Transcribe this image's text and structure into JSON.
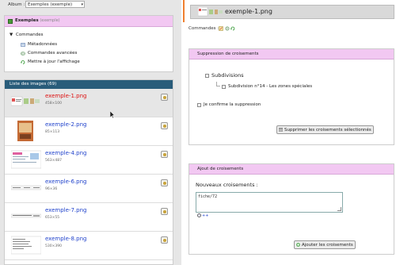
{
  "album": {
    "label": "Album :",
    "selected": "Exemples (exemple)"
  },
  "tree": {
    "root_name": "Exemples",
    "root_suffix": "(exemple)",
    "section": "Commandes",
    "items": [
      "Métadonnées",
      "Commandes avancées",
      "Mettre à jour l'affichage"
    ]
  },
  "images": {
    "header": "Liste des images (69)",
    "rows": [
      {
        "name": "exemple-1.png",
        "size": "458×100",
        "selected": true
      },
      {
        "name": "exemple-2.png",
        "size": "85×113"
      },
      {
        "name": "exemple-4.png",
        "size": "563×487"
      },
      {
        "name": "exemple-6.png",
        "size": "96×36"
      },
      {
        "name": "exemple-7.png",
        "size": "653×55"
      },
      {
        "name": "exemple-8.png",
        "size": "530×390"
      }
    ]
  },
  "detail": {
    "title": "exemple-1.png",
    "commands_label": "Commandes :"
  },
  "suppression": {
    "header": "Suppression de croisements",
    "subdivisions_label": "Subdivisions",
    "subdivision_item": "Subdivision n°14 - Les zones spéciales",
    "confirm_label": "Je confirme la suppression",
    "button": "Supprimer les croisements sélectionnés"
  },
  "ajout": {
    "header": "Ajout de croisements",
    "new_label": "Nouveaux croisements :",
    "textarea_value": "fiche/72",
    "add_more": "++",
    "button": "Ajouter les croisements"
  },
  "colors": {
    "accent_pink": "#f2c8f2",
    "header_blue": "#295c7a",
    "link_blue": "#2244cc",
    "selected_red": "#dd1111",
    "orange": "#f08030"
  }
}
